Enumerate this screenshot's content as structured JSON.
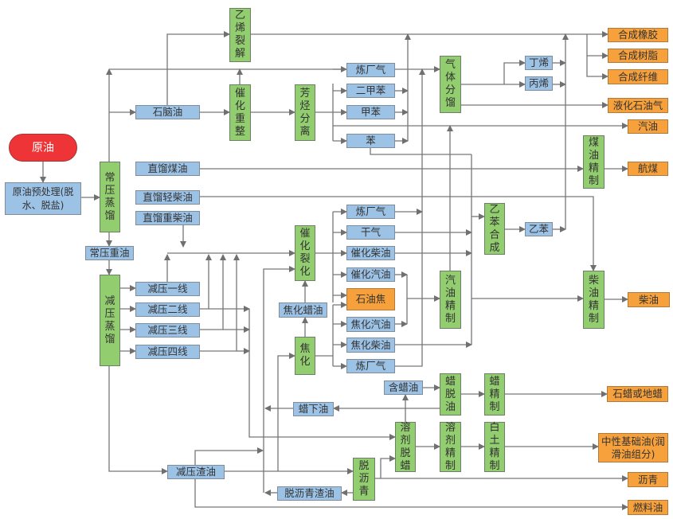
{
  "colors": {
    "process": "#92cd6f",
    "intermediate": "#9cc3e6",
    "product": "#f7a13c",
    "start": "#ee3436",
    "line": "#777777"
  },
  "nodes": {
    "crude": "原油",
    "pretreat": "原油预处理(脱水、脱盐)",
    "atm_dist": "常压蒸馏",
    "atm_resid": "常压重油",
    "vac_dist": "减压蒸馏",
    "naphtha": "石脑油",
    "sr_kerosene": "直馏煤油",
    "sr_light_diesel": "直馏轻柴油",
    "sr_heavy_diesel": "直馏重柴油",
    "vac_1": "减压一线",
    "vac_2": "减压二线",
    "vac_3": "减压三线",
    "vac_4": "减压四线",
    "ethylene_cracking": "乙烯裂解",
    "cat_reforming": "催化重整",
    "aromatics_sep": "芳烃分离",
    "refinery_gas_1": "炼厂气",
    "xylene": "二甲苯",
    "toluene": "甲苯",
    "benzene": "苯",
    "gas_fractionation": "气体分馏",
    "butene": "丁烯",
    "propylene": "丙烯",
    "synthetic_rubber": "合成橡胶",
    "synthetic_resin": "合成树脂",
    "synthetic_fiber": "合成纤维",
    "lpg": "液化石油气",
    "gasoline": "汽油",
    "kerosene_refining": "煤油精制",
    "jet_fuel": "航煤",
    "fcc": "催化裂化",
    "coker_gas_oil": "焦化蜡油",
    "coking": "焦化",
    "refinery_gas_2": "炼厂气",
    "dry_gas": "干气",
    "fcc_diesel": "催化柴油",
    "fcc_gasoline": "催化汽油",
    "petroleum_coke": "石油焦",
    "coker_gasoline": "焦化汽油",
    "coker_diesel": "焦化柴油",
    "refinery_gas_3": "炼厂气",
    "ethylbenzene_synthesis": "乙苯合成",
    "ethylbenzene": "乙苯",
    "gasoline_refining": "汽油精制",
    "diesel_refining": "柴油精制",
    "diesel": "柴油",
    "waxy_oil": "含蜡油",
    "wax_deoiling": "蜡脱油",
    "wax_refining": "蜡精制",
    "paraffin": "石蜡或地蜡",
    "foots_oil": "蜡下油",
    "solvent_dewaxing": "溶剂脱蜡",
    "solvent_refining": "溶剂精制",
    "clay_refining": "白土精制",
    "base_oil": "中性基础油(润滑油组分)",
    "deasphalting": "脱沥青",
    "vac_resid": "减压渣油",
    "deasphalted_resid": "脱沥青渣油",
    "asphalt": "沥青",
    "fuel_oil": "燃料油"
  }
}
